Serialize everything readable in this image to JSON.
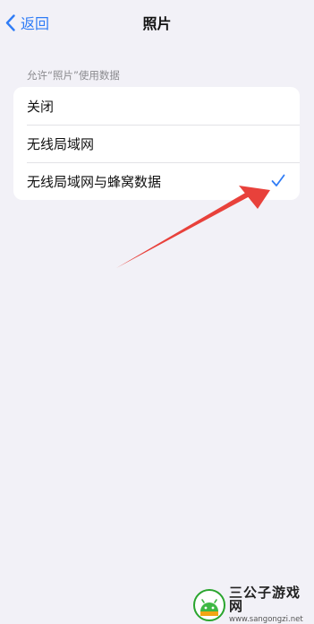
{
  "nav": {
    "back_label": "返回",
    "title": "照片"
  },
  "section": {
    "header": "允许“照片”使用数据"
  },
  "options": [
    {
      "label": "关闭",
      "selected": false
    },
    {
      "label": "无线局域网",
      "selected": false
    },
    {
      "label": "无线局域网与蜂窝数据",
      "selected": true
    }
  ],
  "colors": {
    "accent": "#2f7cf6",
    "background": "#f2f1f7",
    "annotation_arrow": "#e8413b"
  },
  "watermark": {
    "title": "三公子游戏网",
    "url": "www.sangongzi.net"
  }
}
